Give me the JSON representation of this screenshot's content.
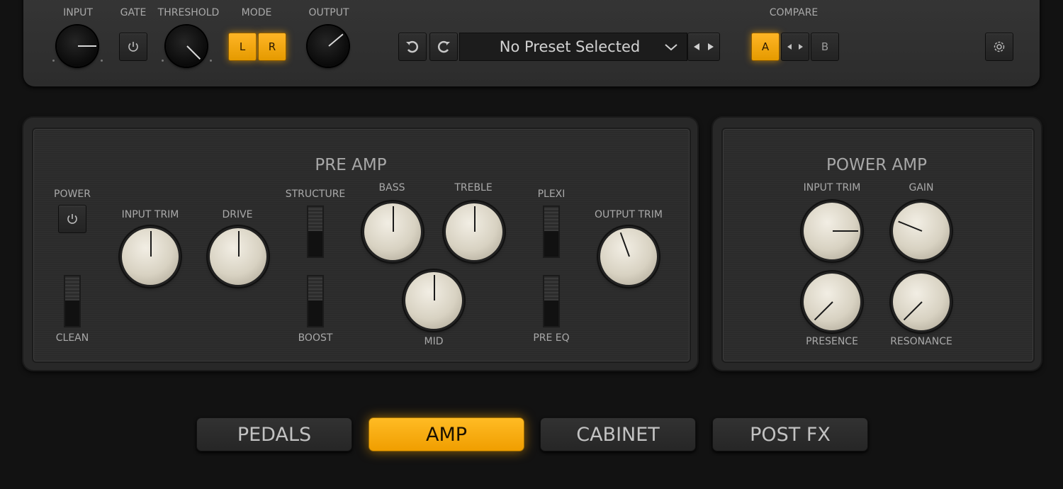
{
  "top": {
    "input_label": "INPUT",
    "gate_label": "GATE",
    "threshold_label": "THRESHOLD",
    "mode_label": "MODE",
    "output_label": "OUTPUT",
    "mode_l": "L",
    "mode_r": "R",
    "preset_name": "No Preset Selected",
    "compare_label": "COMPARE",
    "compare_a": "A",
    "compare_b": "B"
  },
  "preamp": {
    "title": "PRE AMP",
    "power_label": "POWER",
    "clean_label": "CLEAN",
    "input_trim_label": "INPUT TRIM",
    "drive_label": "DRIVE",
    "structure_label": "STRUCTURE",
    "boost_label": "BOOST",
    "bass_label": "BASS",
    "treble_label": "TREBLE",
    "mid_label": "MID",
    "plexi_label": "PLEXI",
    "pre_eq_label": "PRE EQ",
    "output_trim_label": "OUTPUT TRIM"
  },
  "poweramp": {
    "title": "POWER AMP",
    "input_trim_label": "INPUT TRIM",
    "gain_label": "GAIN",
    "presence_label": "PRESENCE",
    "resonance_label": "RESONANCE"
  },
  "tabs": [
    "PEDALS",
    "AMP",
    "CABINET",
    "POST FX"
  ],
  "colors": {
    "accent": "#f5a300",
    "background": "#121212",
    "panel": "#2b2b2b",
    "knob_cream": "#e6e0d2"
  },
  "icons": [
    "power-icon",
    "undo-icon",
    "redo-icon",
    "chevron-down-icon",
    "arrow-left-right-icon",
    "settings-icon"
  ]
}
